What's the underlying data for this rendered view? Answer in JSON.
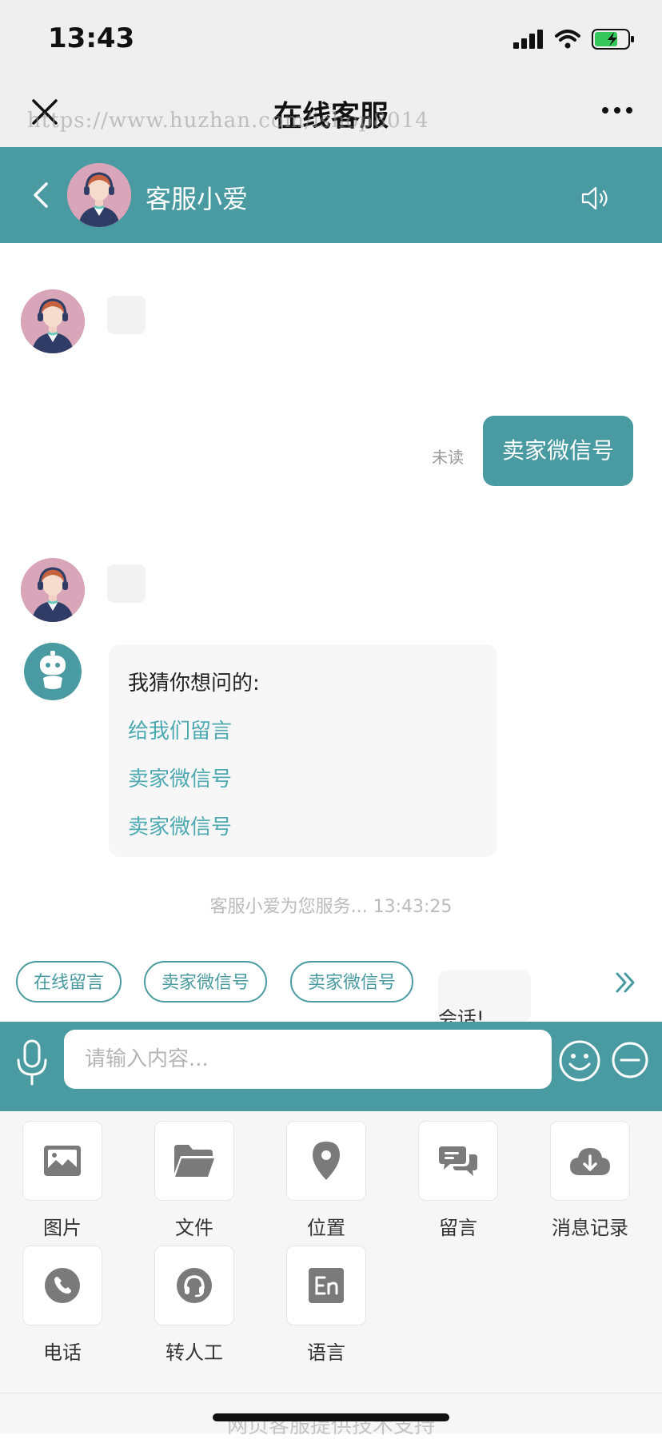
{
  "status_bar": {
    "time": "13:43"
  },
  "nav": {
    "title": "在线客服"
  },
  "watermark": "https://www.huzhan.com/ishop8014",
  "chat_header": {
    "agent_name": "客服小爱"
  },
  "messages": {
    "unread_label": "未读",
    "user_message": "卖家微信号",
    "guess_title": "我猜你想问的:",
    "guess_links": [
      "给我们留言",
      "卖家微信号",
      "卖家微信号"
    ],
    "service_note": "客服小爱为您服务... 13:43:25",
    "partial_bubble": "会话!"
  },
  "quick_replies": [
    "在线留言",
    "卖家微信号",
    "卖家微信号"
  ],
  "input": {
    "placeholder": "请输入内容..."
  },
  "tools": [
    {
      "label": "图片",
      "icon": "image-icon"
    },
    {
      "label": "文件",
      "icon": "folder-icon"
    },
    {
      "label": "位置",
      "icon": "location-pin-icon"
    },
    {
      "label": "留言",
      "icon": "chat-bubbles-icon"
    },
    {
      "label": "消息记录",
      "icon": "cloud-download-icon"
    },
    {
      "label": "电话",
      "icon": "phone-icon"
    },
    {
      "label": "转人工",
      "icon": "headset-icon"
    },
    {
      "label": "语言",
      "icon": "language-icon"
    }
  ],
  "footer": {
    "text": "网页客服提供技术支持"
  },
  "colors": {
    "brand": "#4a9ba1",
    "link": "#4eaab2",
    "panel": "#f6f6f6"
  }
}
